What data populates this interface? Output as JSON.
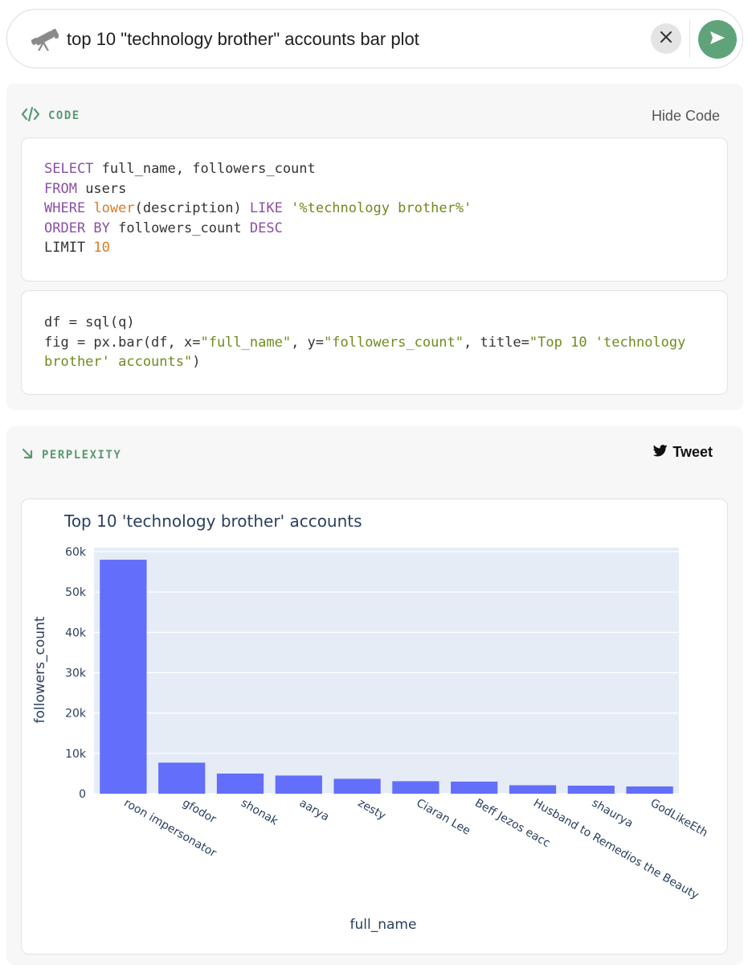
{
  "search": {
    "query": "top 10  \"technology brother\" accounts bar plot",
    "clear_icon": "close-icon",
    "send_icon": "send-icon",
    "accent": "#5fa37a"
  },
  "code_section": {
    "label": "CODE",
    "hide_label": "Hide Code",
    "sql_lines": [
      [
        {
          "t": "SELECT",
          "c": "kw"
        },
        {
          "t": " full_name, followers_count",
          "c": ""
        }
      ],
      [
        {
          "t": "FROM",
          "c": "kw"
        },
        {
          "t": " users",
          "c": ""
        }
      ],
      [
        {
          "t": "WHERE",
          "c": "kw"
        },
        {
          "t": " ",
          "c": ""
        },
        {
          "t": "lower",
          "c": "fn"
        },
        {
          "t": "(description) ",
          "c": ""
        },
        {
          "t": "LIKE",
          "c": "kw"
        },
        {
          "t": " ",
          "c": ""
        },
        {
          "t": "'%technology brother%'",
          "c": "str"
        }
      ],
      [
        {
          "t": "ORDER BY",
          "c": "kw"
        },
        {
          "t": " followers_count ",
          "c": ""
        },
        {
          "t": "DESC",
          "c": "kw"
        }
      ],
      [
        {
          "t": "LIMIT ",
          "c": ""
        },
        {
          "t": "10",
          "c": "num"
        }
      ]
    ],
    "py_lines": [
      [
        {
          "t": "df = sql(q)",
          "c": ""
        }
      ],
      [
        {
          "t": "fig = px.bar(df, x=",
          "c": ""
        },
        {
          "t": "\"full_name\"",
          "c": "str"
        },
        {
          "t": ", y=",
          "c": ""
        },
        {
          "t": "\"followers_count\"",
          "c": "str"
        },
        {
          "t": ", title=",
          "c": ""
        },
        {
          "t": "\"Top 10 'technology",
          "c": "str"
        }
      ],
      [
        {
          "t": "brother' accounts\"",
          "c": "str"
        },
        {
          "t": ")",
          "c": ""
        }
      ]
    ]
  },
  "perplexity_section": {
    "label": "PERPLEXITY",
    "tweet_label": "Tweet"
  },
  "chart_data": {
    "type": "bar",
    "title": "Top 10 'technology brother' accounts",
    "xlabel": "full_name",
    "ylabel": "followers_count",
    "categories": [
      "roon impersonator",
      "gfodor",
      "shonak",
      "aarya",
      "zesty",
      "Ciaran Lee",
      "Beff Jezos  eacc",
      "Husband to Remedios the Beauty",
      "shaurya",
      "GodLikeEth"
    ],
    "values": [
      58000,
      7700,
      5000,
      4500,
      3700,
      3100,
      3000,
      2100,
      2000,
      1800
    ],
    "ylim": [
      0,
      61000
    ],
    "yticks": [
      0,
      10000,
      20000,
      30000,
      40000,
      50000,
      60000
    ],
    "ytick_labels": [
      "0",
      "10k",
      "20k",
      "30k",
      "40k",
      "50k",
      "60k"
    ],
    "grid": true,
    "bar_color": "#636efa",
    "plot_bg": "#e5ecf6"
  }
}
